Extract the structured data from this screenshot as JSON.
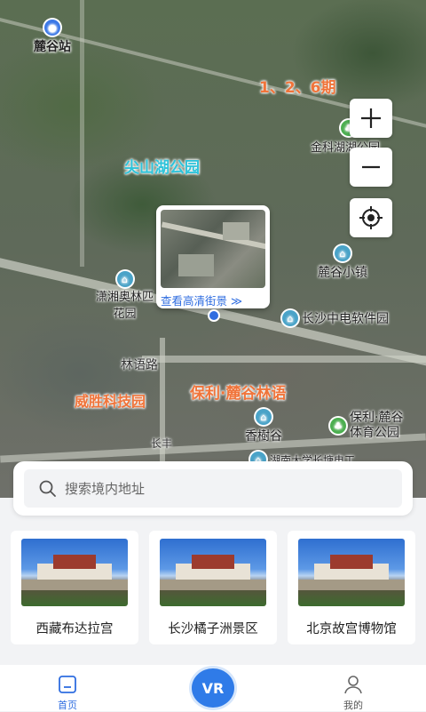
{
  "map": {
    "station_label": "麓谷站",
    "phase_label": "1、2、6期",
    "park_label": "尖山湖公园",
    "jinke_label": "金科湖湖公园",
    "luguxiaozhen_label": "麓谷小镇",
    "xiaoxiang_label_1": "潇湘奥林匹",
    "xiaoxiang_label_2": "花园",
    "cec_label": "长沙中电软件园",
    "linyu_road_label": "林语路",
    "weisheng_label": "威胜科技园",
    "poly_label": "保利·麓谷林语",
    "xiangshugu_label": "香樹谷",
    "sports_label_1": "保利·麓谷",
    "sports_label_2": "体育公园",
    "changfeng_label": "长丰",
    "univ_label": "湖南大学长塘电工",
    "streetview_link": "查看高清街景 ≫",
    "icons": [
      "plus-icon",
      "minus-icon",
      "locate-icon"
    ]
  },
  "search": {
    "placeholder": "搜索境内地址"
  },
  "cards": [
    {
      "title": "西藏布达拉宫"
    },
    {
      "title": "长沙橘子洲景区"
    },
    {
      "title": "北京故宫博物馆"
    }
  ],
  "nav": {
    "home_label": "首页",
    "vr_label": "VR",
    "mine_label": "我的"
  },
  "colors": {
    "accent": "#2f6de0",
    "park_text": "#4fd2e6",
    "district_text": "#f0743a"
  }
}
